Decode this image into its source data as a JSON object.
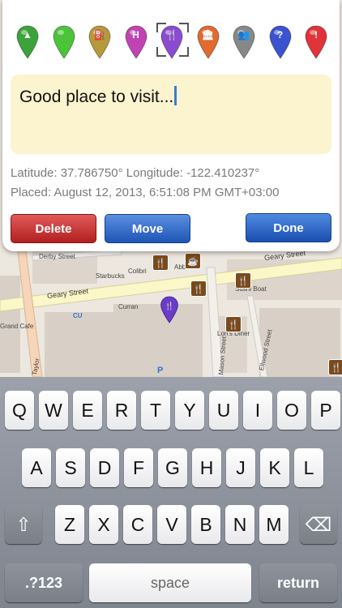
{
  "pin_types": [
    {
      "name": "tree",
      "color": "#3ba33a",
      "symbol": "▲"
    },
    {
      "name": "green",
      "color": "#4cc43a",
      "symbol": ""
    },
    {
      "name": "fuel",
      "color": "#b59a3c",
      "symbol": "⛽"
    },
    {
      "name": "hospital",
      "color": "#c043b3",
      "symbol": "H"
    },
    {
      "name": "restaurant",
      "color": "#8a4bd0",
      "symbol": "🍴"
    },
    {
      "name": "museum",
      "color": "#e06a30",
      "symbol": "🏛"
    },
    {
      "name": "wc",
      "color": "#888888",
      "symbol": "👥"
    },
    {
      "name": "question",
      "color": "#3c53d0",
      "symbol": "?"
    },
    {
      "name": "alert",
      "color": "#e0333a",
      "symbol": "!"
    }
  ],
  "note": {
    "text": "Good place to visit..."
  },
  "location": {
    "coords_line": "Latitude: 37.786750° Longitude: -122.410237°",
    "placed_line": "Placed: August 12, 2013, 6:51:08 PM GMT+03:00"
  },
  "buttons": {
    "delete": "Delete",
    "move": "Move",
    "done": "Done"
  },
  "map_labels": {
    "derby": "Derby Street",
    "geary_left": "Geary Street",
    "geary_right": "Geary Street",
    "starbucks": "Starbucks",
    "colibri": "Colibri",
    "curran": "Curran",
    "grand_cafe": "Grand Cafe",
    "taylor": "Taylor",
    "mason": "Mason Street",
    "ellwood": "Ellwood Street",
    "sushi_boat": "Sushi Boat",
    "lorischamber": "Lori's Diner",
    "cu": "CU",
    "p": "P",
    "abba": "Abba"
  },
  "keyboard": {
    "row1": [
      "Q",
      "W",
      "E",
      "R",
      "T",
      "Y",
      "U",
      "I",
      "O",
      "P"
    ],
    "row2": [
      "A",
      "S",
      "D",
      "F",
      "G",
      "H",
      "J",
      "K",
      "L"
    ],
    "row3": [
      "Z",
      "X",
      "C",
      "V",
      "B",
      "N",
      "M"
    ],
    "shift": "⇧",
    "backspace": "⌫",
    "numbers": ".?123",
    "space": "space",
    "return": "return"
  }
}
